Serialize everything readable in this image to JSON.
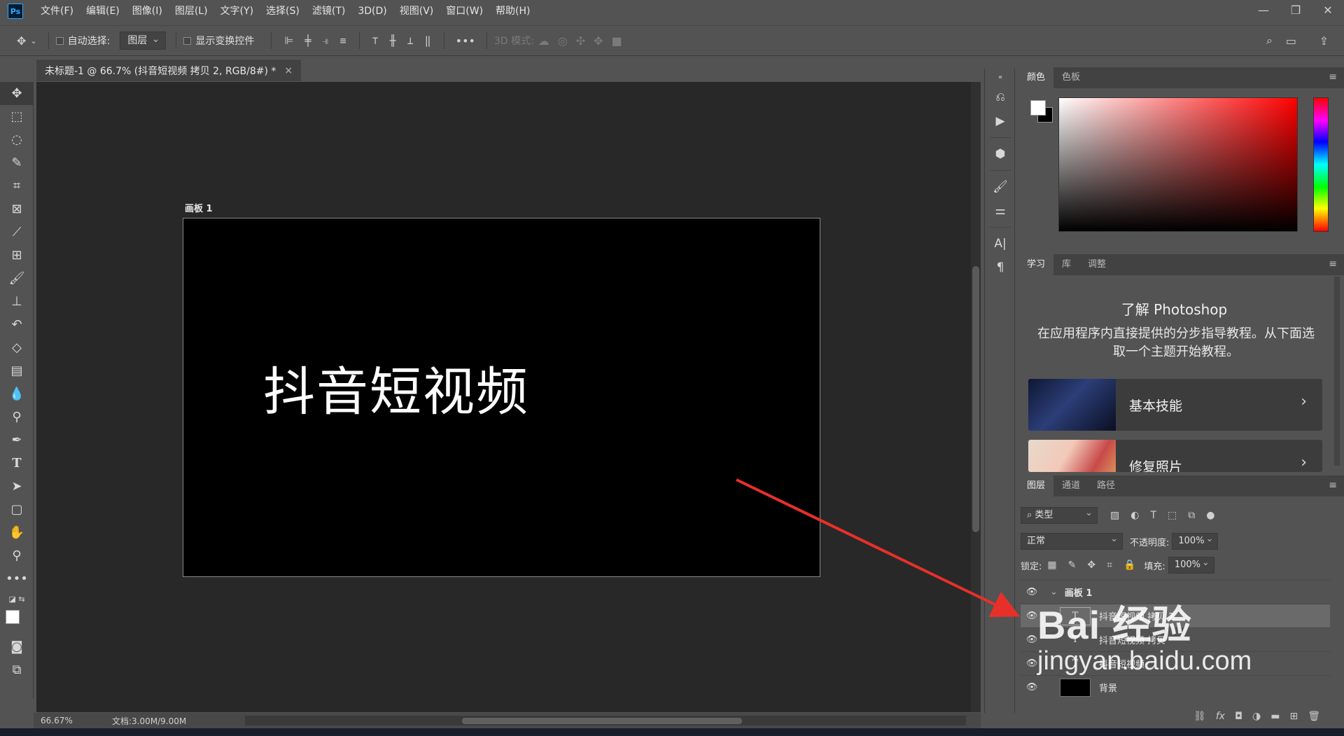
{
  "app": {
    "logo_text": "Ps",
    "menu": [
      "文件(F)",
      "编辑(E)",
      "图像(I)",
      "图层(L)",
      "文字(Y)",
      "选择(S)",
      "滤镜(T)",
      "3D(D)",
      "视图(V)",
      "窗口(W)",
      "帮助(H)"
    ],
    "window_controls": [
      "—",
      "❐",
      "✕"
    ]
  },
  "options": {
    "auto_select_label": "自动选择:",
    "auto_select_value": "图层",
    "show_transform_label": "显示变换控件",
    "mode_3d_label": "3D 模式:"
  },
  "document": {
    "tab_title": "未标题-1 @ 66.7% (抖音短视频 拷贝 2, RGB/8#) *",
    "tab_close": "×",
    "artboard_label": "画板 1",
    "artboard_text": "抖音短视频"
  },
  "status": {
    "zoom": "66.67%",
    "doc_info": "文档:3.00M/9.00M",
    "arrow": "›"
  },
  "color_panel": {
    "tabs": [
      "颜色",
      "色板"
    ],
    "fg_color": "#ffffff",
    "bg_color": "#000000"
  },
  "learn_panel": {
    "tabs": [
      "学习",
      "库",
      "调整"
    ],
    "title": "了解 Photoshop",
    "description": "在应用程序内直接提供的分步指导教程。从下面选取一个主题开始教程。",
    "lessons": [
      {
        "label": "基本技能",
        "arrow": "›"
      },
      {
        "label": "修复照片",
        "arrow": "›"
      }
    ]
  },
  "layers_panel": {
    "tabs": [
      "图层",
      "通道",
      "路径"
    ],
    "filter_label": "类型",
    "blend_mode": "正常",
    "opacity_label": "不透明度:",
    "opacity_value": "100%",
    "lock_label": "锁定:",
    "fill_label": "填充:",
    "fill_value": "100%",
    "layers": [
      {
        "name": "画板 1",
        "type": "artboard",
        "selected": false
      },
      {
        "name": "抖音短视频 拷贝 2",
        "type": "text",
        "selected": true
      },
      {
        "name": "抖音短视频 拷贝",
        "type": "text",
        "selected": false
      },
      {
        "name": "抖音短视频",
        "type": "text",
        "selected": false
      },
      {
        "name": "背景",
        "type": "fill",
        "selected": false
      }
    ]
  },
  "watermark": {
    "logo": "Bai 经验",
    "url": "jingyan.baidu.com"
  },
  "annotation": {
    "arrow_color": "#e8302a"
  }
}
